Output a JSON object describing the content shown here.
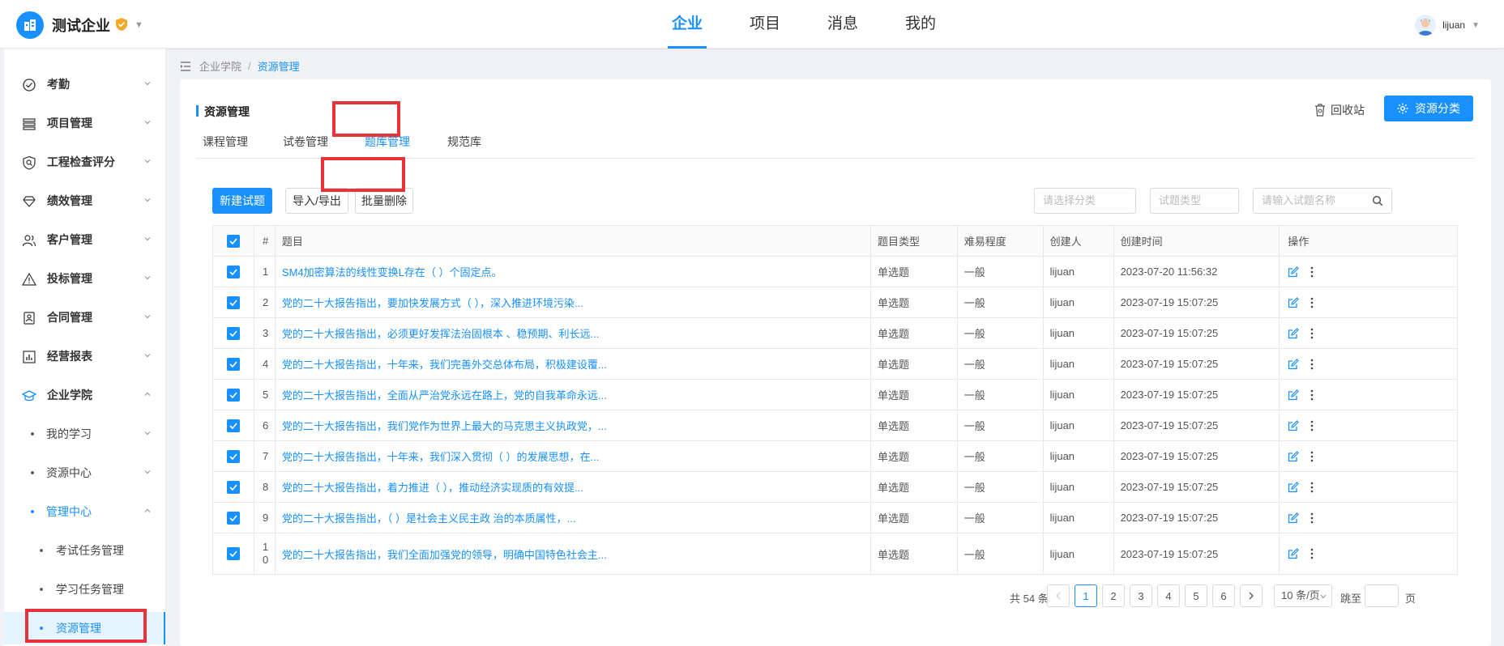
{
  "header": {
    "company": "测试企业",
    "nav": [
      "企业",
      "项目",
      "消息",
      "我的"
    ],
    "active_nav": "企业",
    "username": "lijuan"
  },
  "sidebar": {
    "items": [
      {
        "label": "考勤",
        "icon": "check-circle-icon"
      },
      {
        "label": "项目管理",
        "icon": "list-icon"
      },
      {
        "label": "工程检查评分",
        "icon": "shield-search-icon"
      },
      {
        "label": "绩效管理",
        "icon": "diamond-icon"
      },
      {
        "label": "客户管理",
        "icon": "users-icon"
      },
      {
        "label": "投标管理",
        "icon": "warning-triangle-icon"
      },
      {
        "label": "合同管理",
        "icon": "contract-icon"
      },
      {
        "label": "经营报表",
        "icon": "bar-chart-icon"
      },
      {
        "label": "企业学院",
        "icon": "graduation-cap-icon"
      }
    ],
    "sub_items": [
      "我的学习",
      "资源中心",
      "管理中心"
    ],
    "sub2_items": [
      "考试任务管理",
      "学习任务管理",
      "资源管理"
    ]
  },
  "breadcrumb": [
    "企业学院",
    "资源管理"
  ],
  "page": {
    "title": "资源管理",
    "recycle": "回收站",
    "classify": "资源分类"
  },
  "tabs": [
    "课程管理",
    "试卷管理",
    "题库管理",
    "规范库"
  ],
  "toolbar": {
    "new": "新建试题",
    "import_export": "导入/导出",
    "batch_delete": "批量删除"
  },
  "filters": {
    "category_placeholder": "请选择分类",
    "type_placeholder": "试题类型",
    "name_placeholder": "请输入试题名称"
  },
  "table": {
    "columns": [
      "#",
      "题目",
      "题目类型",
      "难易程度",
      "创建人",
      "创建时间",
      "操作"
    ],
    "rows": [
      {
        "num": "1",
        "title": "SM4加密算法的线性变换L存在（ ）个固定点。",
        "type": "单选题",
        "difficulty": "一般",
        "creator": "lijuan",
        "time": "2023-07-20 11:56:32"
      },
      {
        "num": "2",
        "title": "党的二十大报告指出，要加快发展方式（ ），深入推进环境污染...",
        "type": "单选题",
        "difficulty": "一般",
        "creator": "lijuan",
        "time": "2023-07-19 15:07:25"
      },
      {
        "num": "3",
        "title": "党的二十大报告指出，必须更好发挥法治固根本 、稳预期、利长远...",
        "type": "单选题",
        "difficulty": "一般",
        "creator": "lijuan",
        "time": "2023-07-19 15:07:25"
      },
      {
        "num": "4",
        "title": "党的二十大报告指出，十年来，我们完善外交总体布局，积极建设覆...",
        "type": "单选题",
        "difficulty": "一般",
        "creator": "lijuan",
        "time": "2023-07-19 15:07:25"
      },
      {
        "num": "5",
        "title": "党的二十大报告指出，全面从严治党永远在路上，党的自我革命永远...",
        "type": "单选题",
        "difficulty": "一般",
        "creator": "lijuan",
        "time": "2023-07-19 15:07:25"
      },
      {
        "num": "6",
        "title": "党的二十大报告指出，我们党作为世界上最大的马克思主义执政党，...",
        "type": "单选题",
        "difficulty": "一般",
        "creator": "lijuan",
        "time": "2023-07-19 15:07:25"
      },
      {
        "num": "7",
        "title": "党的二十大报告指出，十年来，我们深入贯彻（ ）的发展思想，在...",
        "type": "单选题",
        "difficulty": "一般",
        "creator": "lijuan",
        "time": "2023-07-19 15:07:25"
      },
      {
        "num": "8",
        "title": "党的二十大报告指出，着力推进（ ），推动经济实现质的有效提...",
        "type": "单选题",
        "difficulty": "一般",
        "creator": "lijuan",
        "time": "2023-07-19 15:07:25"
      },
      {
        "num": "9",
        "title": "党的二十大报告指出，（ ）是社会主义民主政 治的本质属性，...",
        "type": "单选题",
        "difficulty": "一般",
        "creator": "lijuan",
        "time": "2023-07-19 15:07:25"
      },
      {
        "num": "10",
        "title": "党的二十大报告指出，我们全面加强党的领导，明确中国特色社会主...",
        "type": "单选题",
        "difficulty": "一般",
        "creator": "lijuan",
        "time": "2023-07-19 15:07:25"
      }
    ]
  },
  "pagination": {
    "total": "共 54 条",
    "pages": [
      "1",
      "2",
      "3",
      "4",
      "5",
      "6"
    ],
    "current": "1",
    "page_size": "10 条/页",
    "jump_label": "跳至",
    "jump_unit": "页"
  },
  "colors": {
    "accent": "#1890ff",
    "highlight": "#e8333a"
  }
}
